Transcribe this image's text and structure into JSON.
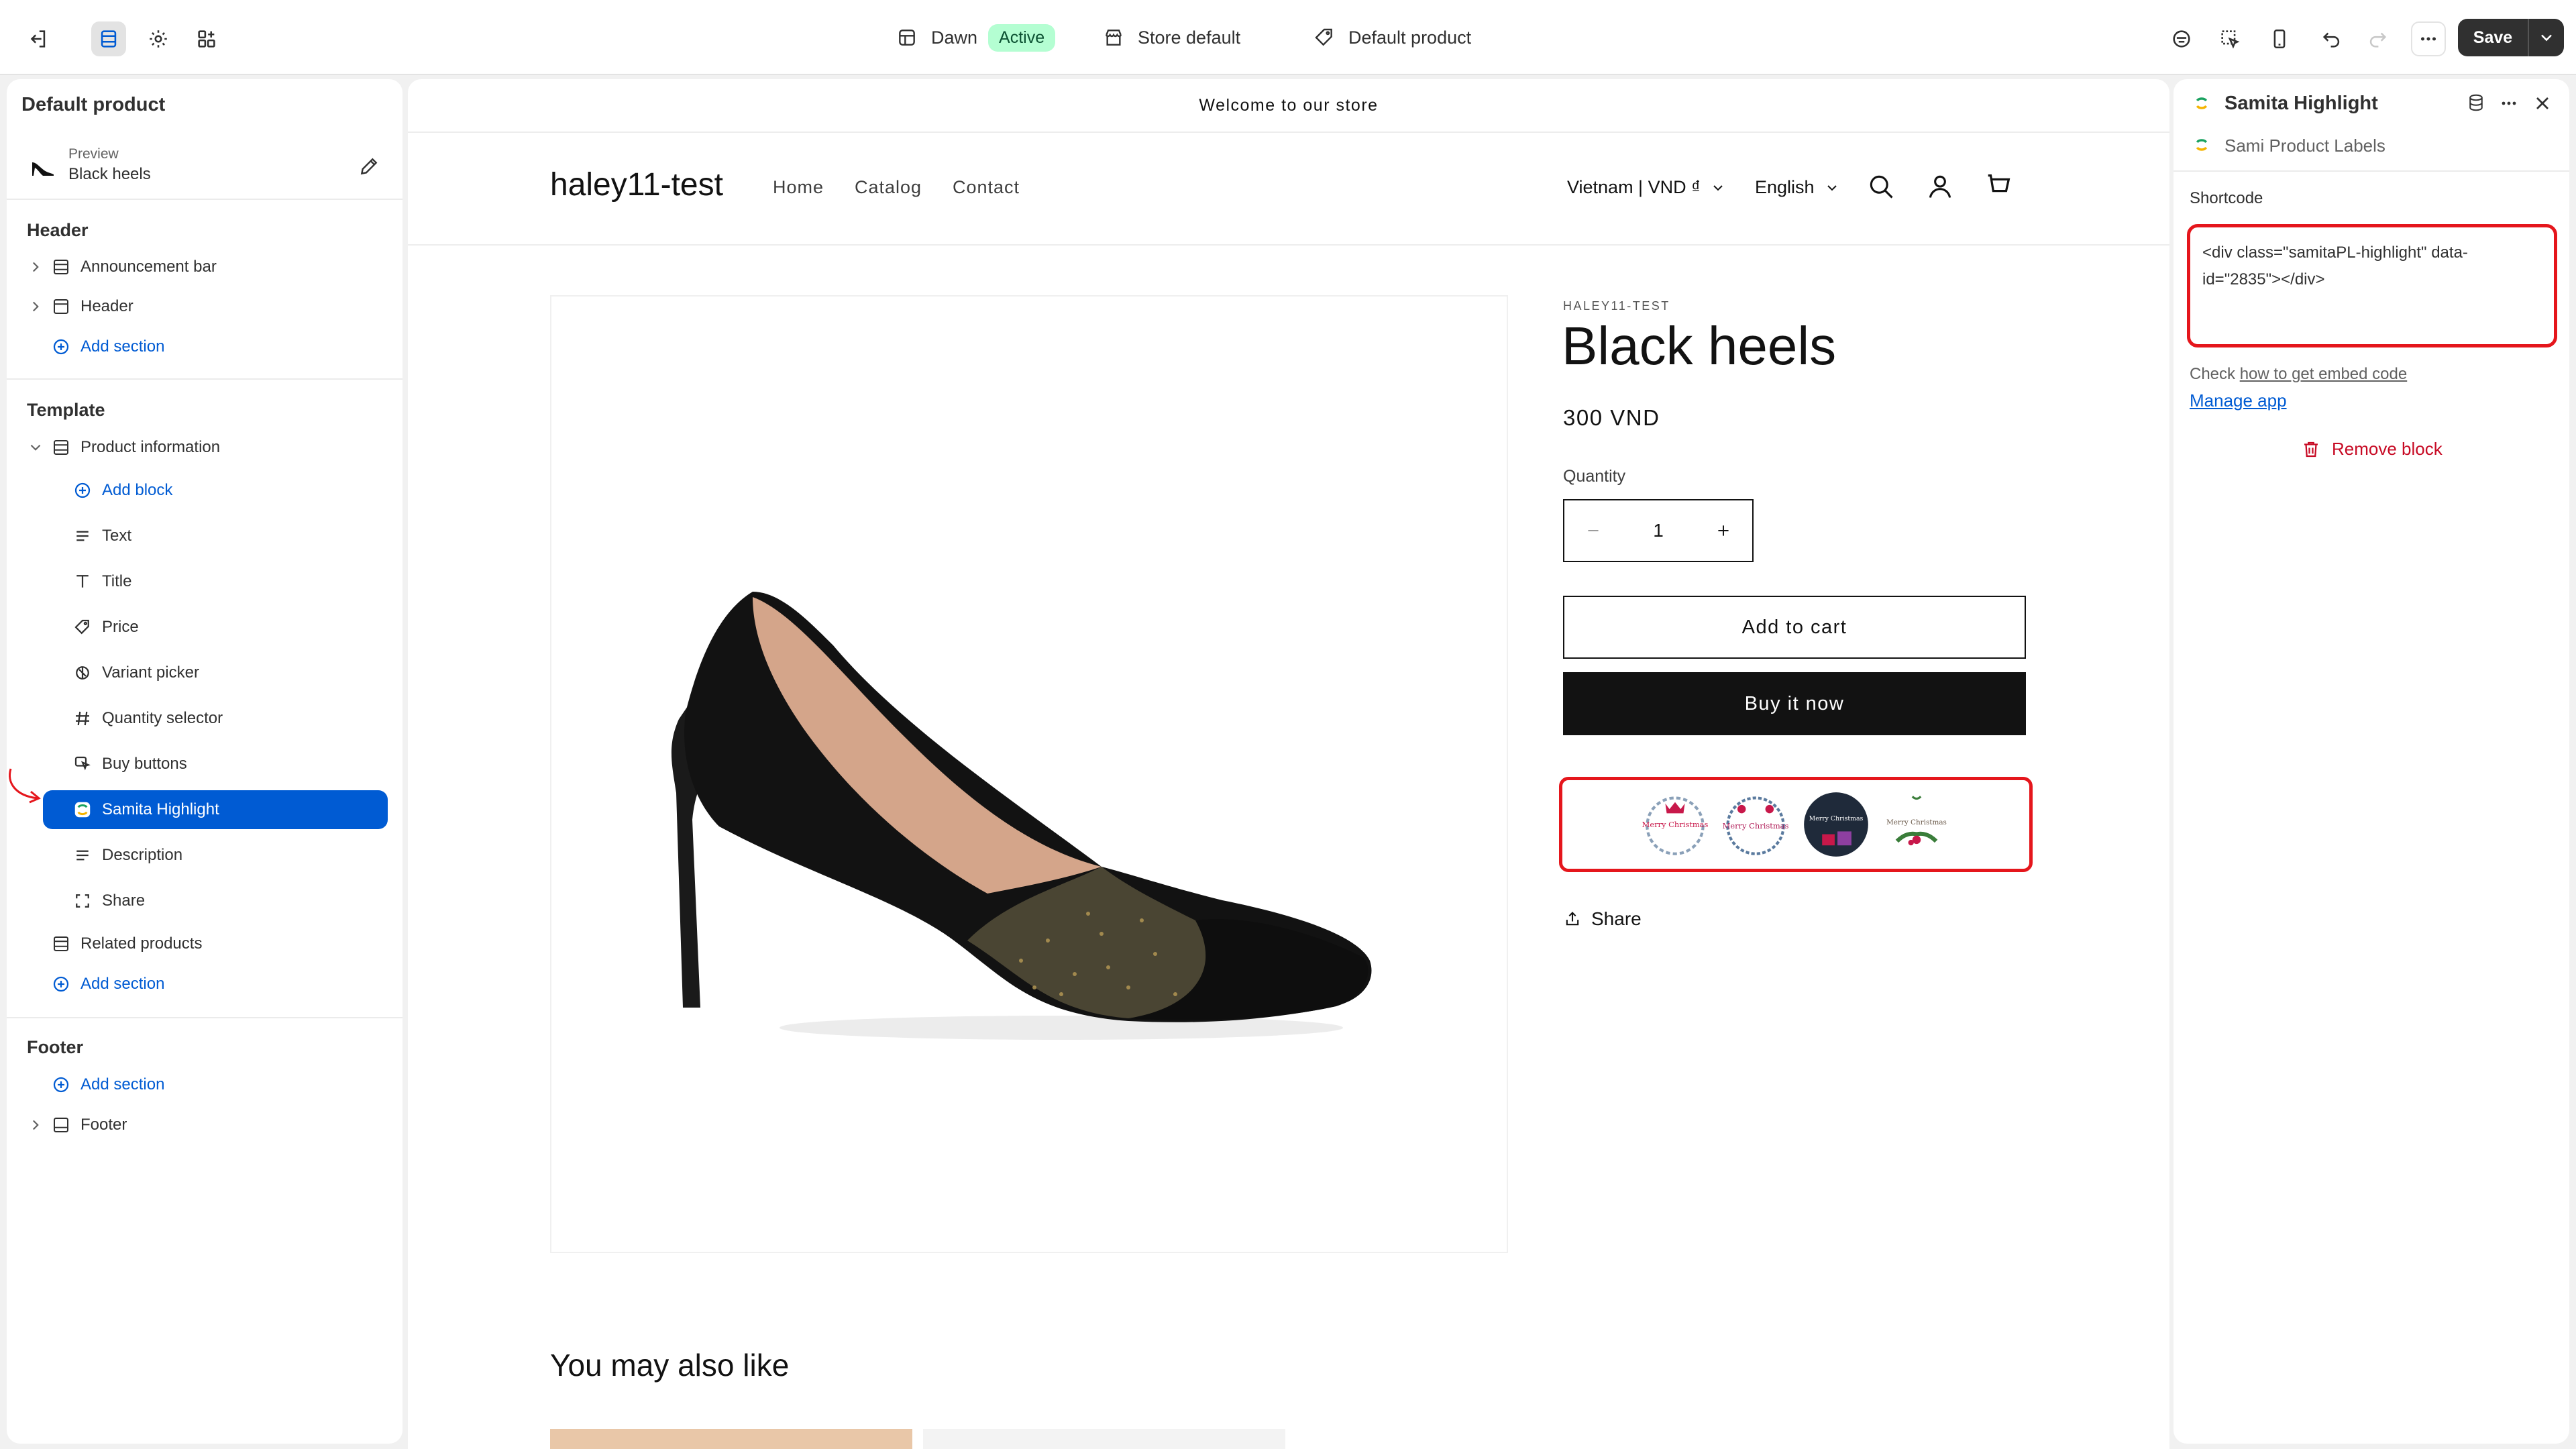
{
  "topbar": {
    "theme_name": "Dawn",
    "theme_status": "Active",
    "store_label": "Store default",
    "template_label": "Default product",
    "save_label": "Save"
  },
  "left_panel": {
    "title": "Default product",
    "preview": {
      "caption": "Preview",
      "product": "Black heels"
    },
    "header_section": {
      "title": "Header",
      "items": [
        {
          "label": "Announcement bar"
        },
        {
          "label": "Header"
        }
      ],
      "add_label": "Add section"
    },
    "template_section": {
      "title": "Template",
      "group_label": "Product information",
      "add_block_label": "Add block",
      "blocks": [
        {
          "label": "Text",
          "icon": "text-icon"
        },
        {
          "label": "Title",
          "icon": "title-icon"
        },
        {
          "label": "Price",
          "icon": "price-tag-icon"
        },
        {
          "label": "Variant picker",
          "icon": "variant-icon"
        },
        {
          "label": "Quantity selector",
          "icon": "hash-icon"
        },
        {
          "label": "Buy buttons",
          "icon": "cursor-icon"
        },
        {
          "label": "Samita Highlight",
          "icon": "samita-app-icon",
          "selected": true
        },
        {
          "label": "Description",
          "icon": "text-icon"
        },
        {
          "label": "Share",
          "icon": "share-frame-icon"
        }
      ],
      "related_label": "Related products",
      "add_section_label": "Add section"
    },
    "footer_section": {
      "title": "Footer",
      "add_label": "Add section",
      "items": [
        {
          "label": "Footer"
        }
      ]
    }
  },
  "storefront": {
    "announcement": "Welcome to our store",
    "store_name": "haley11-test",
    "nav": [
      "Home",
      "Catalog",
      "Contact"
    ],
    "currency": "Vietnam | VND ₫",
    "language": "English",
    "vendor": "HALEY11-TEST",
    "product_title": "Black heels",
    "price": "300 VND",
    "quantity_label": "Quantity",
    "quantity_value": "1",
    "add_to_cart": "Add to cart",
    "buy_now": "Buy it now",
    "share": "Share",
    "labels": [
      {
        "text": "Merry Christmas",
        "style": "wreath-pink"
      },
      {
        "text": "Merry Christmas",
        "style": "wreath-blue"
      },
      {
        "text": "Merry Christmas",
        "style": "dark-circle"
      },
      {
        "text": "Merry Christmas",
        "style": "holly"
      }
    ],
    "recommend_title": "You may also like"
  },
  "right_panel": {
    "block_title": "Samita Highlight",
    "app_name": "Sami Product Labels",
    "shortcode_label": "Shortcode",
    "shortcode_value": "<div class=\"samitaPL-highlight\" data-id=\"2835\"></div>",
    "check_prefix": "Check",
    "check_link": "how to get embed code",
    "manage_app": "Manage app",
    "remove_block": "Remove block"
  },
  "colors": {
    "accent": "#005bd3",
    "highlight_red": "#e5161c",
    "active_badge_bg": "#b4fed2",
    "remove_red": "#c70a24"
  }
}
